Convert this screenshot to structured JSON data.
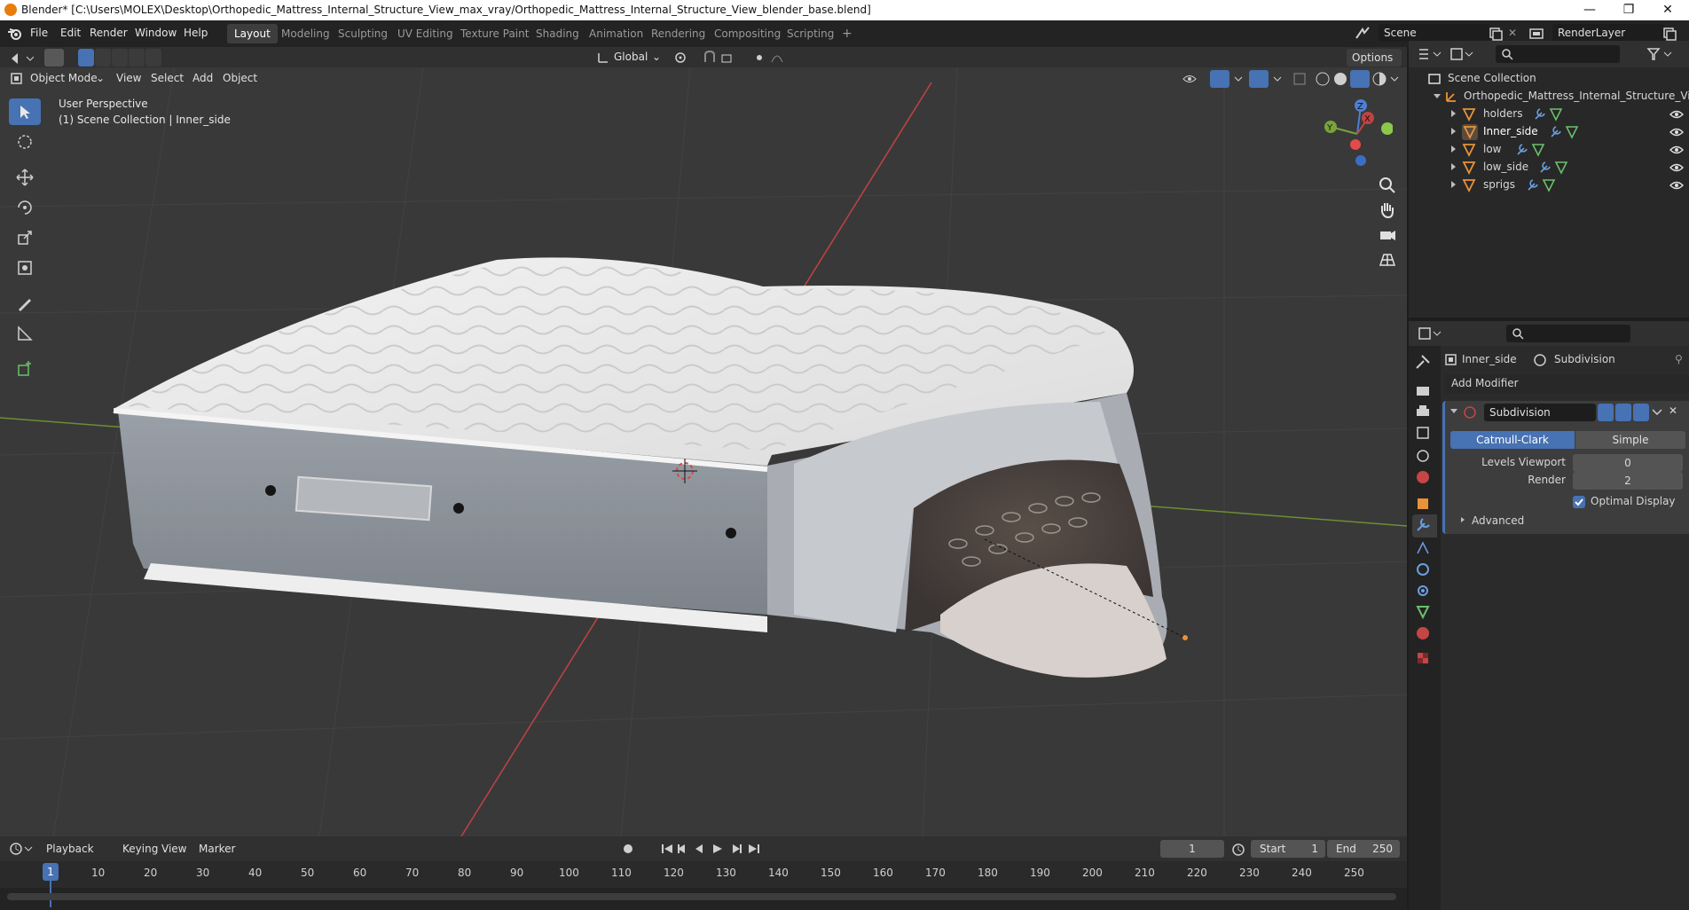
{
  "window": {
    "title": "Blender* [C:\\Users\\MOLEX\\Desktop\\Orthopedic_Mattress_Internal_Structure_View_max_vray/Orthopedic_Mattress_Internal_Structure_View_blender_base.blend]",
    "min_glyph": "—",
    "max_glyph": "❐",
    "close_glyph": "✕"
  },
  "menu": {
    "items": [
      "File",
      "Edit",
      "Render",
      "Window",
      "Help"
    ]
  },
  "workspaces": {
    "tabs": [
      "Layout",
      "Modeling",
      "Sculpting",
      "UV Editing",
      "Texture Paint",
      "Shading",
      "Animation",
      "Rendering",
      "Compositing",
      "Scripting"
    ],
    "active": "Layout",
    "add": "+"
  },
  "scene": {
    "name": "Scene",
    "render_layer": "RenderLayer"
  },
  "viewport_header": {
    "transform_orientation": "Global",
    "options": "Options",
    "mode": "Object Mode",
    "menus": [
      "View",
      "Select",
      "Add",
      "Object"
    ]
  },
  "viewport": {
    "perspective": "User Perspective",
    "collection_info": "(1) Scene Collection | Inner_side",
    "gizmo": {
      "z": "Z",
      "y": "Y",
      "x": "X"
    }
  },
  "outliner": {
    "root": "Scene Collection",
    "collection": "Orthopedic_Mattress_Internal_Structure_Vie",
    "objects": [
      "holders",
      "Inner_side",
      "low",
      "low_side",
      "sprigs"
    ],
    "selected": "Inner_side"
  },
  "properties": {
    "object": "Inner_side",
    "modifier_breadcrumb": "Subdivision",
    "add_modifier": "Add Modifier",
    "modifier": {
      "name": "Subdivision",
      "types": [
        "Catmull-Clark",
        "Simple"
      ],
      "active_type": "Catmull-Clark",
      "levels_viewport_label": "Levels Viewport",
      "levels_viewport": "0",
      "render_label": "Render",
      "render": "2",
      "optimal_display_label": "Optimal Display",
      "optimal_display": true,
      "advanced": "Advanced"
    }
  },
  "timeline": {
    "menus": [
      "Playback",
      "Keying",
      "View",
      "Marker"
    ],
    "current_frame": "1",
    "start_label": "Start",
    "start": "1",
    "end_label": "End",
    "end": "250",
    "ticks": [
      "10",
      "20",
      "30",
      "40",
      "50",
      "60",
      "70",
      "80",
      "90",
      "100",
      "110",
      "120",
      "130",
      "140",
      "150",
      "160",
      "170",
      "180",
      "190",
      "200",
      "210",
      "220",
      "230",
      "240",
      "250"
    ],
    "playhead": "1"
  },
  "colors": {
    "accent": "#4772b3",
    "header": "#303030",
    "viewport_bg": "#393939",
    "axis_x": "#c14343",
    "axis_y": "#7aa33b",
    "object_orange": "#e8933a"
  }
}
